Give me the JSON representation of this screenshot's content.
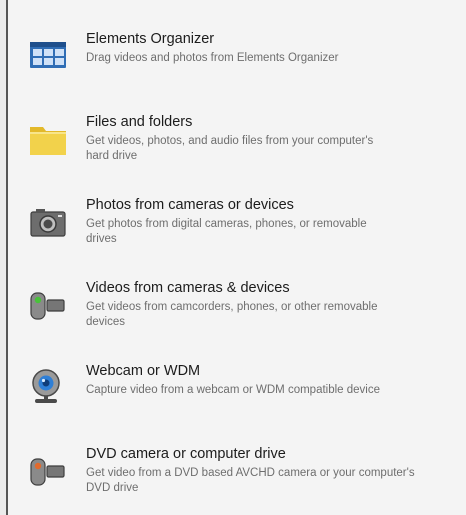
{
  "items": [
    {
      "icon": "grid-icon",
      "title": "Elements Organizer",
      "desc": "Drag videos and photos from Elements Organizer"
    },
    {
      "icon": "folder-icon",
      "title": "Files and folders",
      "desc": "Get videos, photos, and audio files from your computer's hard drive"
    },
    {
      "icon": "camera-icon",
      "title": "Photos from cameras or devices",
      "desc": "Get photos from digital cameras, phones, or removable drives"
    },
    {
      "icon": "camcorder-icon",
      "title": "Videos from cameras & devices",
      "desc": "Get videos from camcorders, phones, or other removable devices"
    },
    {
      "icon": "webcam-icon",
      "title": "Webcam or WDM",
      "desc": "Capture video from a webcam or WDM compatible device"
    },
    {
      "icon": "dvd-camera-icon",
      "title": "DVD camera or computer drive",
      "desc": "Get video from a DVD based AVCHD camera or your computer's DVD drive"
    }
  ],
  "colors": {
    "panel_bg": "#f4f4f4",
    "border": "#555555",
    "grid_icon": "#2f6db5",
    "folder_icon": "#f2d24b",
    "green_led": "#48c33a",
    "orange_led": "#e26a2c"
  }
}
